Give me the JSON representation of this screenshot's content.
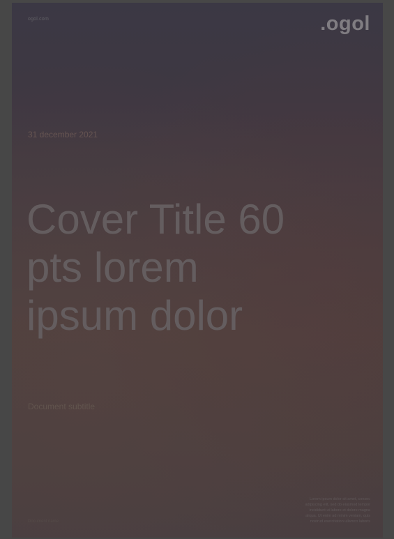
{
  "page": {
    "url": "ogol.com",
    "logo": ".ogol",
    "date": "31 december 2021",
    "title": "Cover Title 60 pts lorem ipsum dolor",
    "subtitle": "Document subtitle",
    "footer_left": "Document name",
    "footer_right_lines": [
      "Lorem ipsum dolor sit amet, consec",
      "adipiscing elit, sed do eiusmod tempor",
      "incididunt ut labore et dolore magna",
      "aliqua. Ut enim ad minim veniam, quis",
      "nostrud exercitation ullamco laboris"
    ]
  },
  "colors": {
    "background": "#474747",
    "page_top": "#3b3746",
    "page_bottom": "#4a3f42",
    "title_text": "#6d6567"
  }
}
